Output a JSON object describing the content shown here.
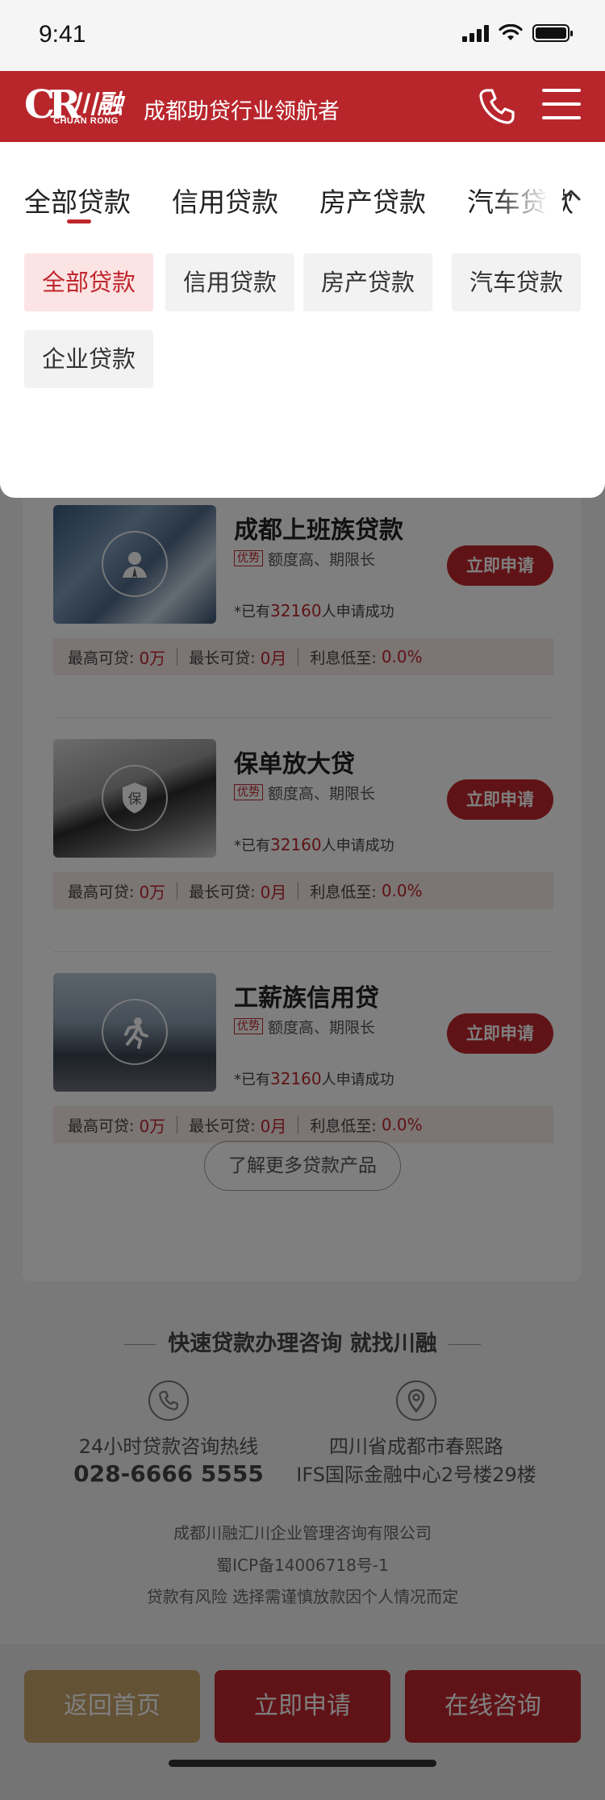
{
  "status_bar": {
    "time": "9:41"
  },
  "header": {
    "logo": {
      "mark": "CR",
      "cn": "川融",
      "en": "CHUAN RONG"
    },
    "slogan": "成都助贷行业领航者"
  },
  "loans": [
    {
      "title": "成都上班族贷款",
      "tag": "优势",
      "advantage": "额度高、期限长",
      "count_prefix": "*已有",
      "count": "32160",
      "count_suffix": "人申请成功",
      "apply": "立即申请",
      "max_amount_label": "最高可贷:",
      "max_amount": "0万",
      "max_term_label": "最长可贷:",
      "max_term": "0月",
      "rate_label": "利息低至:",
      "rate": "0.0%",
      "icon": "user-icon"
    },
    {
      "title": "保单放大贷",
      "tag": "优势",
      "advantage": "额度高、期限长",
      "count_prefix": "*已有",
      "count": "32160",
      "count_suffix": "人申请成功",
      "apply": "立即申请",
      "max_amount_label": "最高可贷:",
      "max_amount": "0万",
      "max_term_label": "最长可贷:",
      "max_term": "0月",
      "rate_label": "利息低至:",
      "rate": "0.0%",
      "icon": "shield-icon",
      "icon_text": "保"
    },
    {
      "title": "工薪族信用贷",
      "tag": "优势",
      "advantage": "额度高、期限长",
      "count_prefix": "*已有",
      "count": "32160",
      "count_suffix": "人申请成功",
      "apply": "立即申请",
      "max_amount_label": "最高可贷:",
      "max_amount": "0万",
      "max_term_label": "最长可贷:",
      "max_term": "0月",
      "rate_label": "利息低至:",
      "rate": "0.0%",
      "icon": "runner-icon"
    }
  ],
  "more_button": "了解更多贷款产品",
  "footer": {
    "title": "快速贷款办理咨询 就找川融",
    "hotline_label": "24小时贷款咨询热线",
    "hotline": "028-6666 5555",
    "address_line1": "四川省成都市春熙路",
    "address_line2": "IFS国际金融中心2号楼29楼",
    "company": "成都川融汇川企业管理咨询有限公司",
    "icp": "蜀ICP备14006718号-1",
    "risk": "贷款有风险  选择需谨慎放款因个人情况而定"
  },
  "bottom_bar": {
    "home": "返回首页",
    "apply": "立即申请",
    "consult": "在线咨询"
  },
  "colors": {
    "brand_red": "#b8262c",
    "accent_red": "#c0272d",
    "gold": "#c9a56a"
  },
  "dropdown": {
    "tabs": [
      "全部贷款",
      "信用贷款",
      "房产贷款",
      "汽车贷款"
    ],
    "active_tab": "全部贷款",
    "chips": [
      "全部贷款",
      "信用贷款",
      "房产贷款",
      "汽车贷款",
      "企业贷款"
    ],
    "active_chip": "全部贷款"
  }
}
